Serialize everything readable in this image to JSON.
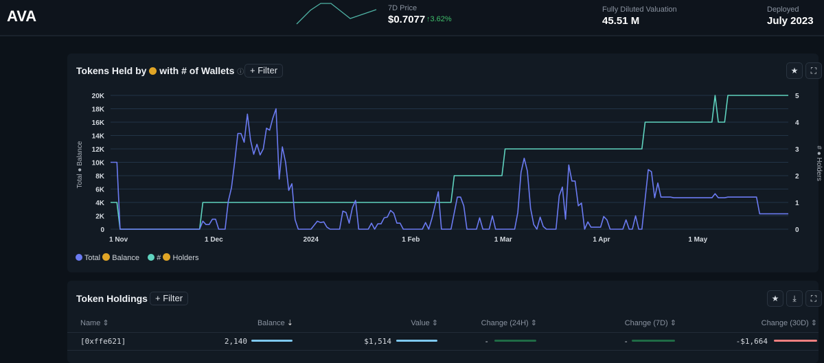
{
  "header": {
    "token": "AVA",
    "price_label": "7D Price",
    "price": "$0.7077",
    "price_change": "↑3.62%",
    "fdv_label": "Fully Diluted Valuation",
    "fdv": "45.51 M",
    "deployed_label": "Deployed",
    "deployed": "July 2023"
  },
  "chart_card": {
    "title_prefix": "Tokens Held by",
    "title_suffix": "with # of Wallets",
    "filter_label": "+ Filter",
    "legend": [
      {
        "label_prefix": "Total",
        "label_suffix": "Balance",
        "color": "#6b7bf2"
      },
      {
        "label_prefix": "#",
        "label_suffix": "Holders",
        "color": "#5fd3bf"
      }
    ]
  },
  "chart_data": {
    "type": "line",
    "ylabel_left_prefix": "Total",
    "ylabel_left_suffix": "Balance",
    "ylabel_right_prefix": "#",
    "ylabel_right_suffix": "Holders",
    "ylim_left": [
      0,
      20000
    ],
    "ylim_right": [
      0,
      5
    ],
    "yticks_left": [
      "0",
      "2K",
      "4K",
      "6K",
      "8K",
      "10K",
      "12K",
      "14K",
      "16K",
      "18K",
      "20K"
    ],
    "yticks_right": [
      "0",
      "1",
      "2",
      "3",
      "4",
      "5"
    ],
    "xticks": [
      {
        "label": "1 Nov",
        "date": "2023-11-01"
      },
      {
        "label": "1 Dec",
        "date": "2023-12-01"
      },
      {
        "label": "2024",
        "date": "2024-01-01"
      },
      {
        "label": "1 Feb",
        "date": "2024-02-01"
      },
      {
        "label": "1 Mar",
        "date": "2024-03-01"
      },
      {
        "label": "1 Apr",
        "date": "2024-04-01"
      },
      {
        "label": "1 May",
        "date": "2024-05-01"
      }
    ],
    "xlim": [
      "2023-11-01",
      "2024-06-01"
    ],
    "grid": true,
    "legend_position": "bottom-left",
    "series": [
      {
        "name": "Total Balance",
        "axis": "left",
        "color": "#6b7bf2",
        "points": [
          [
            "2023-11-01",
            10000
          ],
          [
            "2023-11-03",
            10000
          ],
          [
            "2023-11-04",
            0
          ],
          [
            "2023-11-29",
            0
          ],
          [
            "2023-11-30",
            1200
          ],
          [
            "2023-12-01",
            700
          ],
          [
            "2023-12-02",
            700
          ],
          [
            "2023-12-03",
            1500
          ],
          [
            "2023-12-04",
            1500
          ],
          [
            "2023-12-05",
            0
          ],
          [
            "2023-12-07",
            0
          ],
          [
            "2023-12-08",
            4200
          ],
          [
            "2023-12-09",
            6200
          ],
          [
            "2023-12-10",
            10000
          ],
          [
            "2023-12-11",
            14300
          ],
          [
            "2023-12-12",
            14300
          ],
          [
            "2023-12-13",
            13000
          ],
          [
            "2023-12-14",
            17200
          ],
          [
            "2023-12-15",
            13300
          ],
          [
            "2023-12-16",
            11200
          ],
          [
            "2023-12-17",
            12700
          ],
          [
            "2023-12-18",
            11100
          ],
          [
            "2023-12-19",
            12000
          ],
          [
            "2023-12-20",
            15100
          ],
          [
            "2023-12-21",
            14800
          ],
          [
            "2023-12-22",
            16600
          ],
          [
            "2023-12-23",
            18000
          ],
          [
            "2023-12-24",
            7500
          ],
          [
            "2023-12-25",
            12300
          ],
          [
            "2023-12-26",
            10000
          ],
          [
            "2023-12-27",
            5800
          ],
          [
            "2023-12-28",
            6800
          ],
          [
            "2023-12-29",
            1400
          ],
          [
            "2023-12-30",
            0
          ],
          [
            "2024-01-03",
            0
          ],
          [
            "2024-01-05",
            1200
          ],
          [
            "2024-01-06",
            1000
          ],
          [
            "2024-01-07",
            1100
          ],
          [
            "2024-01-08",
            300
          ],
          [
            "2024-01-09",
            0
          ],
          [
            "2024-01-12",
            0
          ],
          [
            "2024-01-13",
            2700
          ],
          [
            "2024-01-14",
            2500
          ],
          [
            "2024-01-15",
            900
          ],
          [
            "2024-01-16",
            3200
          ],
          [
            "2024-01-17",
            4300
          ],
          [
            "2024-01-18",
            0
          ],
          [
            "2024-01-21",
            0
          ],
          [
            "2024-01-22",
            900
          ],
          [
            "2024-01-23",
            0
          ],
          [
            "2024-01-24",
            800
          ],
          [
            "2024-01-25",
            800
          ],
          [
            "2024-01-26",
            1700
          ],
          [
            "2024-01-27",
            1800
          ],
          [
            "2024-01-28",
            2800
          ],
          [
            "2024-01-29",
            2400
          ],
          [
            "2024-01-30",
            900
          ],
          [
            "2024-01-31",
            900
          ],
          [
            "2024-02-01",
            0
          ],
          [
            "2024-02-07",
            0
          ],
          [
            "2024-02-08",
            1000
          ],
          [
            "2024-02-09",
            0
          ],
          [
            "2024-02-10",
            1600
          ],
          [
            "2024-02-12",
            5600
          ],
          [
            "2024-02-13",
            0
          ],
          [
            "2024-02-16",
            0
          ],
          [
            "2024-02-18",
            4800
          ],
          [
            "2024-02-19",
            4800
          ],
          [
            "2024-02-20",
            3500
          ],
          [
            "2024-02-21",
            0
          ],
          [
            "2024-02-24",
            0
          ],
          [
            "2024-02-25",
            1700
          ],
          [
            "2024-02-26",
            0
          ],
          [
            "2024-02-28",
            0
          ],
          [
            "2024-02-29",
            2000
          ],
          [
            "2024-03-01",
            0
          ],
          [
            "2024-03-07",
            0
          ],
          [
            "2024-03-08",
            2500
          ],
          [
            "2024-03-09",
            8500
          ],
          [
            "2024-03-10",
            10600
          ],
          [
            "2024-03-11",
            8700
          ],
          [
            "2024-03-12",
            3100
          ],
          [
            "2024-03-13",
            700
          ],
          [
            "2024-03-14",
            0
          ],
          [
            "2024-03-15",
            1800
          ],
          [
            "2024-03-16",
            400
          ],
          [
            "2024-03-17",
            0
          ],
          [
            "2024-03-20",
            0
          ],
          [
            "2024-03-21",
            5000
          ],
          [
            "2024-03-22",
            6300
          ],
          [
            "2024-03-23",
            1500
          ],
          [
            "2024-03-24",
            9600
          ],
          [
            "2024-03-25",
            7200
          ],
          [
            "2024-03-26",
            7200
          ],
          [
            "2024-03-27",
            3500
          ],
          [
            "2024-03-28",
            3900
          ],
          [
            "2024-03-29",
            0
          ],
          [
            "2024-03-30",
            1100
          ],
          [
            "2024-03-31",
            300
          ],
          [
            "2024-04-03",
            300
          ],
          [
            "2024-04-04",
            1900
          ],
          [
            "2024-04-05",
            1400
          ],
          [
            "2024-04-06",
            0
          ],
          [
            "2024-04-10",
            0
          ],
          [
            "2024-04-11",
            1400
          ],
          [
            "2024-04-12",
            0
          ],
          [
            "2024-04-13",
            0
          ],
          [
            "2024-04-14",
            2000
          ],
          [
            "2024-04-15",
            0
          ],
          [
            "2024-04-16",
            0
          ],
          [
            "2024-04-18",
            8900
          ],
          [
            "2024-04-19",
            8600
          ],
          [
            "2024-04-20",
            4700
          ],
          [
            "2024-04-21",
            6900
          ],
          [
            "2024-04-22",
            4800
          ],
          [
            "2024-04-25",
            4800
          ],
          [
            "2024-04-26",
            4700
          ],
          [
            "2024-05-08",
            4700
          ],
          [
            "2024-05-09",
            5300
          ],
          [
            "2024-05-10",
            4700
          ],
          [
            "2024-05-12",
            4700
          ],
          [
            "2024-05-13",
            4800
          ],
          [
            "2024-05-22",
            4800
          ],
          [
            "2024-05-23",
            2300
          ],
          [
            "2024-06-01",
            2300
          ]
        ]
      },
      {
        "name": "Holders",
        "axis": "right",
        "color": "#5fd3bf",
        "points": [
          [
            "2023-11-01",
            1
          ],
          [
            "2023-11-03",
            1
          ],
          [
            "2023-11-04",
            0
          ],
          [
            "2023-11-29",
            0
          ],
          [
            "2023-11-30",
            1
          ],
          [
            "2024-02-16",
            1
          ],
          [
            "2024-02-17",
            2
          ],
          [
            "2024-03-03",
            2
          ],
          [
            "2024-03-04",
            3
          ],
          [
            "2024-04-16",
            3
          ],
          [
            "2024-04-17",
            4
          ],
          [
            "2024-05-08",
            4
          ],
          [
            "2024-05-09",
            5
          ],
          [
            "2024-05-10",
            4
          ],
          [
            "2024-05-12",
            4
          ],
          [
            "2024-05-13",
            5
          ],
          [
            "2024-06-01",
            5
          ]
        ]
      }
    ]
  },
  "holdings": {
    "title": "Token Holdings",
    "filter_label": "+ Filter",
    "columns": [
      "Name",
      "Balance",
      "Value",
      "Change (24H)",
      "Change (7D)",
      "Change (30D)"
    ],
    "rows": [
      {
        "name": "[0xffe621]",
        "balance": "2,140",
        "value": "$1,514",
        "change_24h": "-",
        "change_7d": "-",
        "change_30d": "-$1,664"
      }
    ]
  }
}
